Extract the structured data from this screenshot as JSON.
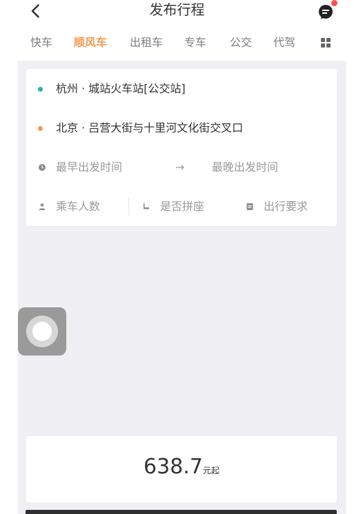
{
  "header": {
    "title": "发布行程"
  },
  "tabs": [
    {
      "label": "快车",
      "active": false
    },
    {
      "label": "顺风车",
      "active": true
    },
    {
      "label": "出租车",
      "active": false
    },
    {
      "label": "专车",
      "active": false
    },
    {
      "label": "公交",
      "active": false
    },
    {
      "label": "代驾",
      "active": false
    }
  ],
  "route": {
    "start": "杭州 · 城站火车站[公交站]",
    "end": "北京 · 吕营大街与十里河文化街交叉口",
    "earliest": "最早出发时间",
    "arrow": "→",
    "latest": "最晚出发时间"
  },
  "options": {
    "passengers": "乘车人数",
    "carpool": "是否拼座",
    "requirements": "出行要求"
  },
  "price": {
    "value": "638.7",
    "suffix": "元起"
  },
  "colors": {
    "accent": "#f29b53",
    "start_dot": "#2bb39b",
    "end_dot": "#f29b53",
    "badge": "#ff4d4f"
  },
  "icons": {
    "back": "back-icon",
    "message": "message-icon",
    "grid": "grid-icon",
    "clock": "clock-icon",
    "person": "person-icon",
    "seat": "seat-icon",
    "note": "note-icon"
  }
}
